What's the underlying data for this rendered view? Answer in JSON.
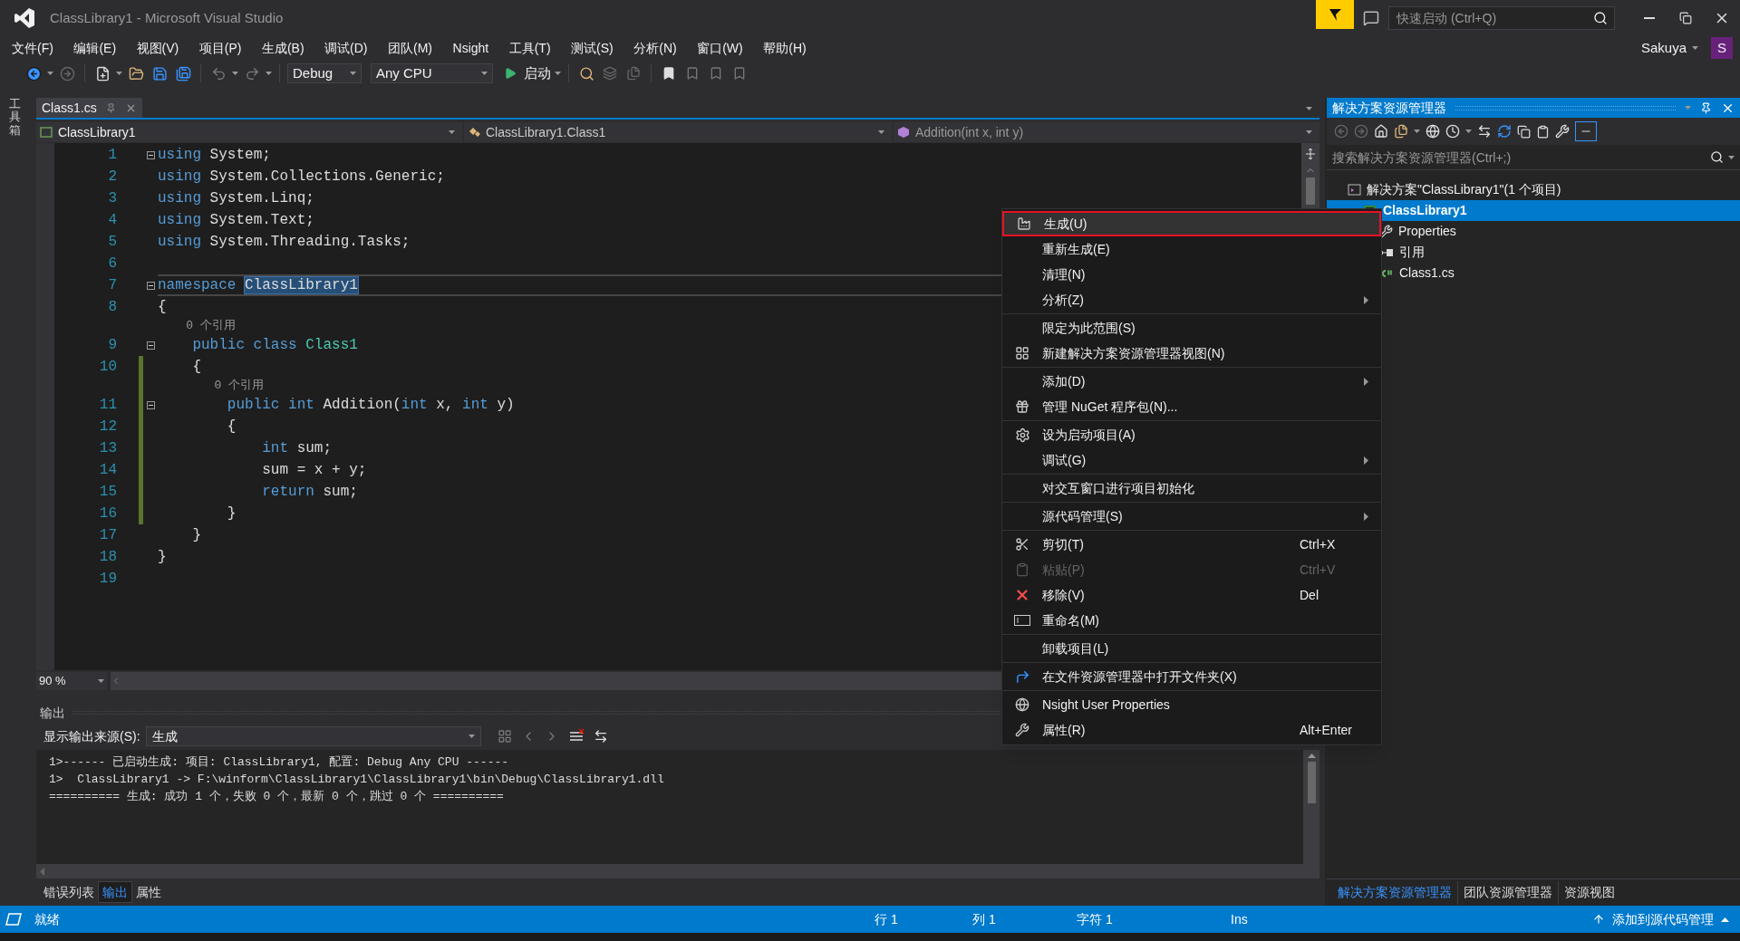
{
  "window": {
    "title": "ClassLibrary1 - Microsoft Visual Studio"
  },
  "quick_launch": {
    "placeholder": "快速启动 (Ctrl+Q)"
  },
  "user": {
    "name": "Sakuya",
    "initial": "S"
  },
  "menu": [
    "文件(F)",
    "编辑(E)",
    "视图(V)",
    "项目(P)",
    "生成(B)",
    "调试(D)",
    "团队(M)",
    "Nsight",
    "工具(T)",
    "测试(S)",
    "分析(N)",
    "窗口(W)",
    "帮助(H)"
  ],
  "toolbar": {
    "configuration": "Debug",
    "platform": "Any CPU",
    "start": "启动"
  },
  "toolbox_tab": "工具箱",
  "document_tabs": [
    {
      "label": "Class1.cs",
      "selected": true
    }
  ],
  "navigation": [
    "ClassLibrary1",
    "ClassLibrary1.Class1",
    "Addition(int x, int y)"
  ],
  "editor": {
    "zoom": "90 %",
    "lines": [
      {
        "kind": "code",
        "number": "1",
        "fold": true,
        "changed": false,
        "current": false,
        "tokens": [
          {
            "kind": "keyword",
            "text": "using"
          },
          {
            "kind": "plain",
            "text": " System;"
          }
        ]
      },
      {
        "kind": "code",
        "number": "2",
        "fold": false,
        "changed": false,
        "current": false,
        "tokens": [
          {
            "kind": "keyword",
            "text": "using"
          },
          {
            "kind": "plain",
            "text": " System.Collections.Generic;"
          }
        ]
      },
      {
        "kind": "code",
        "number": "3",
        "fold": false,
        "changed": false,
        "current": false,
        "tokens": [
          {
            "kind": "keyword",
            "text": "using"
          },
          {
            "kind": "plain",
            "text": " System.Linq;"
          }
        ]
      },
      {
        "kind": "code",
        "number": "4",
        "fold": false,
        "changed": false,
        "current": false,
        "tokens": [
          {
            "kind": "keyword",
            "text": "using"
          },
          {
            "kind": "plain",
            "text": " System.Text;"
          }
        ]
      },
      {
        "kind": "code",
        "number": "5",
        "fold": false,
        "changed": false,
        "current": false,
        "tokens": [
          {
            "kind": "keyword",
            "text": "using"
          },
          {
            "kind": "plain",
            "text": " System.Threading.Tasks;"
          }
        ]
      },
      {
        "kind": "code",
        "number": "6",
        "fold": false,
        "changed": false,
        "current": false
      },
      {
        "kind": "code",
        "number": "7",
        "fold": true,
        "changed": false,
        "current": true,
        "tokens": [
          {
            "kind": "keyword",
            "text": "namespace "
          },
          {
            "kind": "highlight",
            "text": "ClassLibrary1"
          }
        ]
      },
      {
        "kind": "code",
        "number": "8",
        "fold": false,
        "changed": false,
        "current": false,
        "tokens": [
          {
            "kind": "plain",
            "text": "{"
          }
        ]
      },
      {
        "kind": "codelens",
        "changed": false,
        "text": "    0 个引用"
      },
      {
        "kind": "code",
        "number": "9",
        "fold": true,
        "changed": false,
        "current": false,
        "tokens": [
          {
            "kind": "keyword",
            "text": "    public class "
          },
          {
            "kind": "type",
            "text": "Class1"
          }
        ]
      },
      {
        "kind": "code",
        "number": "10",
        "fold": false,
        "changed": true,
        "current": false,
        "tokens": [
          {
            "kind": "plain",
            "text": "    {"
          }
        ]
      },
      {
        "kind": "codelens",
        "changed": true,
        "text": "        0 个引用"
      },
      {
        "kind": "code",
        "number": "11",
        "fold": true,
        "changed": true,
        "current": false,
        "tokens": [
          {
            "kind": "keyword",
            "text": "        public int"
          },
          {
            "kind": "plain",
            "text": " Addition("
          },
          {
            "kind": "keyword",
            "text": "int"
          },
          {
            "kind": "plain",
            "text": " x, "
          },
          {
            "kind": "keyword",
            "text": "int"
          },
          {
            "kind": "plain",
            "text": " y)"
          }
        ]
      },
      {
        "kind": "code",
        "number": "12",
        "fold": false,
        "changed": true,
        "current": false,
        "tokens": [
          {
            "kind": "plain",
            "text": "        {"
          }
        ]
      },
      {
        "kind": "code",
        "number": "13",
        "fold": false,
        "changed": true,
        "current": false,
        "tokens": [
          {
            "kind": "keyword",
            "text": "            int"
          },
          {
            "kind": "plain",
            "text": " sum;"
          }
        ]
      },
      {
        "kind": "code",
        "number": "14",
        "fold": false,
        "changed": true,
        "current": false,
        "tokens": [
          {
            "kind": "plain",
            "text": "            sum = x + y;"
          }
        ]
      },
      {
        "kind": "code",
        "number": "15",
        "fold": false,
        "changed": true,
        "current": false,
        "tokens": [
          {
            "kind": "keyword",
            "text": "            return"
          },
          {
            "kind": "plain",
            "text": " sum;"
          }
        ]
      },
      {
        "kind": "code",
        "number": "16",
        "fold": false,
        "changed": true,
        "current": false,
        "tokens": [
          {
            "kind": "plain",
            "text": "        }"
          }
        ]
      },
      {
        "kind": "code",
        "number": "17",
        "fold": false,
        "changed": false,
        "current": false,
        "tokens": [
          {
            "kind": "plain",
            "text": "    }"
          }
        ]
      },
      {
        "kind": "code",
        "number": "18",
        "fold": false,
        "changed": false,
        "current": false,
        "tokens": [
          {
            "kind": "plain",
            "text": "}"
          }
        ]
      },
      {
        "kind": "code",
        "number": "19",
        "fold": false,
        "changed": false,
        "current": false
      }
    ]
  },
  "output": {
    "title": "输出",
    "source_label": "显示输出来源(S):",
    "source": "生成",
    "lines": [
      "1>------ 已启动生成: 项目: ClassLibrary1, 配置: Debug Any CPU ------",
      "1>  ClassLibrary1 -> F:\\winform\\ClassLibrary1\\ClassLibrary1\\bin\\Debug\\ClassLibrary1.dll",
      "========== 生成: 成功 1 个，失败 0 个，最新 0 个，跳过 0 个 =========="
    ]
  },
  "bottom_tabs": [
    {
      "label": "错误列表",
      "selected": false
    },
    {
      "label": "输出",
      "selected": true
    },
    {
      "label": "属性",
      "selected": false
    }
  ],
  "solution_explorer": {
    "title": "解决方案资源管理器",
    "search": {
      "placeholder": "搜索解决方案资源管理器(Ctrl+;)"
    },
    "tree": [
      {
        "kind": "solution",
        "label": "解决方案\"ClassLibrary1\"(1 个项目)",
        "selected": false,
        "children": [
          {
            "kind": "project",
            "label": "ClassLibrary1",
            "selected": true,
            "children": [
              {
                "kind": "properties",
                "label": "Properties",
                "selected": false
              },
              {
                "kind": "references",
                "label": "引用",
                "selected": false
              },
              {
                "kind": "csharp",
                "label": "Class1.cs",
                "selected": false
              }
            ]
          }
        ]
      }
    ],
    "tabs": [
      {
        "label": "解决方案资源管理器",
        "selected": true
      },
      {
        "label": "团队资源管理器",
        "selected": false
      },
      {
        "label": "资源视图",
        "selected": false
      }
    ]
  },
  "context_menu": {
    "groups": [
      [
        {
          "label": "生成(U)",
          "selected": true,
          "submenu": false,
          "disabled": false
        },
        {
          "label": "重新生成(E)",
          "selected": false,
          "submenu": false,
          "disabled": false
        },
        {
          "label": "清理(N)",
          "selected": false,
          "submenu": false,
          "disabled": false
        },
        {
          "label": "分析(Z)",
          "selected": false,
          "submenu": true,
          "disabled": false
        }
      ],
      [
        {
          "label": "限定为此范围(S)",
          "selected": false,
          "submenu": false,
          "disabled": false
        },
        {
          "label": "新建解决方案资源管理器视图(N)",
          "selected": false,
          "submenu": false,
          "disabled": false
        }
      ],
      [
        {
          "label": "添加(D)",
          "selected": false,
          "submenu": true,
          "disabled": false
        },
        {
          "label": "管理 NuGet 程序包(N)...",
          "selected": false,
          "submenu": false,
          "disabled": false
        }
      ],
      [
        {
          "label": "设为启动项目(A)",
          "selected": false,
          "submenu": false,
          "disabled": false
        },
        {
          "label": "调试(G)",
          "selected": false,
          "submenu": true,
          "disabled": false
        }
      ],
      [
        {
          "label": "对交互窗口进行项目初始化",
          "selected": false,
          "submenu": false,
          "disabled": false
        }
      ],
      [
        {
          "label": "源代码管理(S)",
          "selected": false,
          "submenu": true,
          "disabled": false
        }
      ],
      [
        {
          "label": "剪切(T)",
          "shortcut": "Ctrl+X",
          "selected": false,
          "submenu": false,
          "disabled": false
        },
        {
          "label": "粘贴(P)",
          "shortcut": "Ctrl+V",
          "selected": false,
          "submenu": false,
          "disabled": true
        },
        {
          "label": "移除(V)",
          "shortcut": "Del",
          "selected": false,
          "submenu": false,
          "disabled": false
        },
        {
          "label": "重命名(M)",
          "selected": false,
          "submenu": false,
          "disabled": false
        }
      ],
      [
        {
          "label": "卸载项目(L)",
          "selected": false,
          "submenu": false,
          "disabled": false
        }
      ],
      [
        {
          "label": "在文件资源管理器中打开文件夹(X)",
          "selected": false,
          "submenu": false,
          "disabled": false
        }
      ],
      [
        {
          "label": "Nsight User Properties",
          "selected": false,
          "submenu": false,
          "disabled": false
        },
        {
          "label": "属性(R)",
          "shortcut": "Alt+Enter",
          "selected": false,
          "submenu": false,
          "disabled": false
        }
      ]
    ]
  },
  "status_bar": {
    "state": "就绪",
    "line": "行 1",
    "column": "列 1",
    "char": "字符 1",
    "mode": "Ins",
    "source_control": "添加到源代码管理"
  }
}
